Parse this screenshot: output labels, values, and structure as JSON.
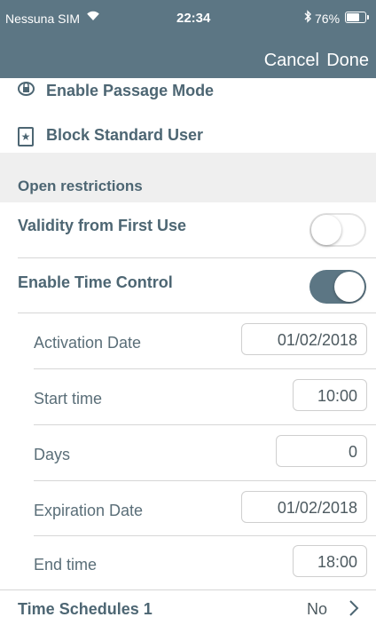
{
  "status_bar": {
    "carrier": "Nessuna SIM",
    "wifi_icon": "ᮿ",
    "time": "22:34",
    "bluetooth_icon": "✱",
    "battery_percent": "76%",
    "battery_level": 0.76
  },
  "nav": {
    "cancel_label": "Cancel",
    "done_label": "Done",
    "background_color": "#5c7684"
  },
  "options": {
    "passage_mode_label": "Enable Passage Mode",
    "block_user_label": "Block Standard User",
    "block_user_icon_glyph": "★"
  },
  "open_restrictions": {
    "header": "Open restrictions",
    "validity_first_use": {
      "label": "Validity from First Use",
      "enabled": false
    },
    "time_control": {
      "label": "Enable Time Control",
      "enabled": true
    },
    "fields": {
      "activation_date": {
        "label": "Activation Date",
        "value": "01/02/2018"
      },
      "start_time": {
        "label": "Start time",
        "value": "10:00"
      },
      "days": {
        "label": "Days",
        "value": "0"
      },
      "expiration_date": {
        "label": "Expiration Date",
        "value": "01/02/2018"
      },
      "end_time": {
        "label": "End time",
        "value": "18:00"
      }
    }
  },
  "time_schedules": {
    "label": "Time Schedules 1",
    "value": "No"
  },
  "colors": {
    "accent": "#5c7684",
    "text": "#4d6673",
    "section_background": "#efefef"
  }
}
